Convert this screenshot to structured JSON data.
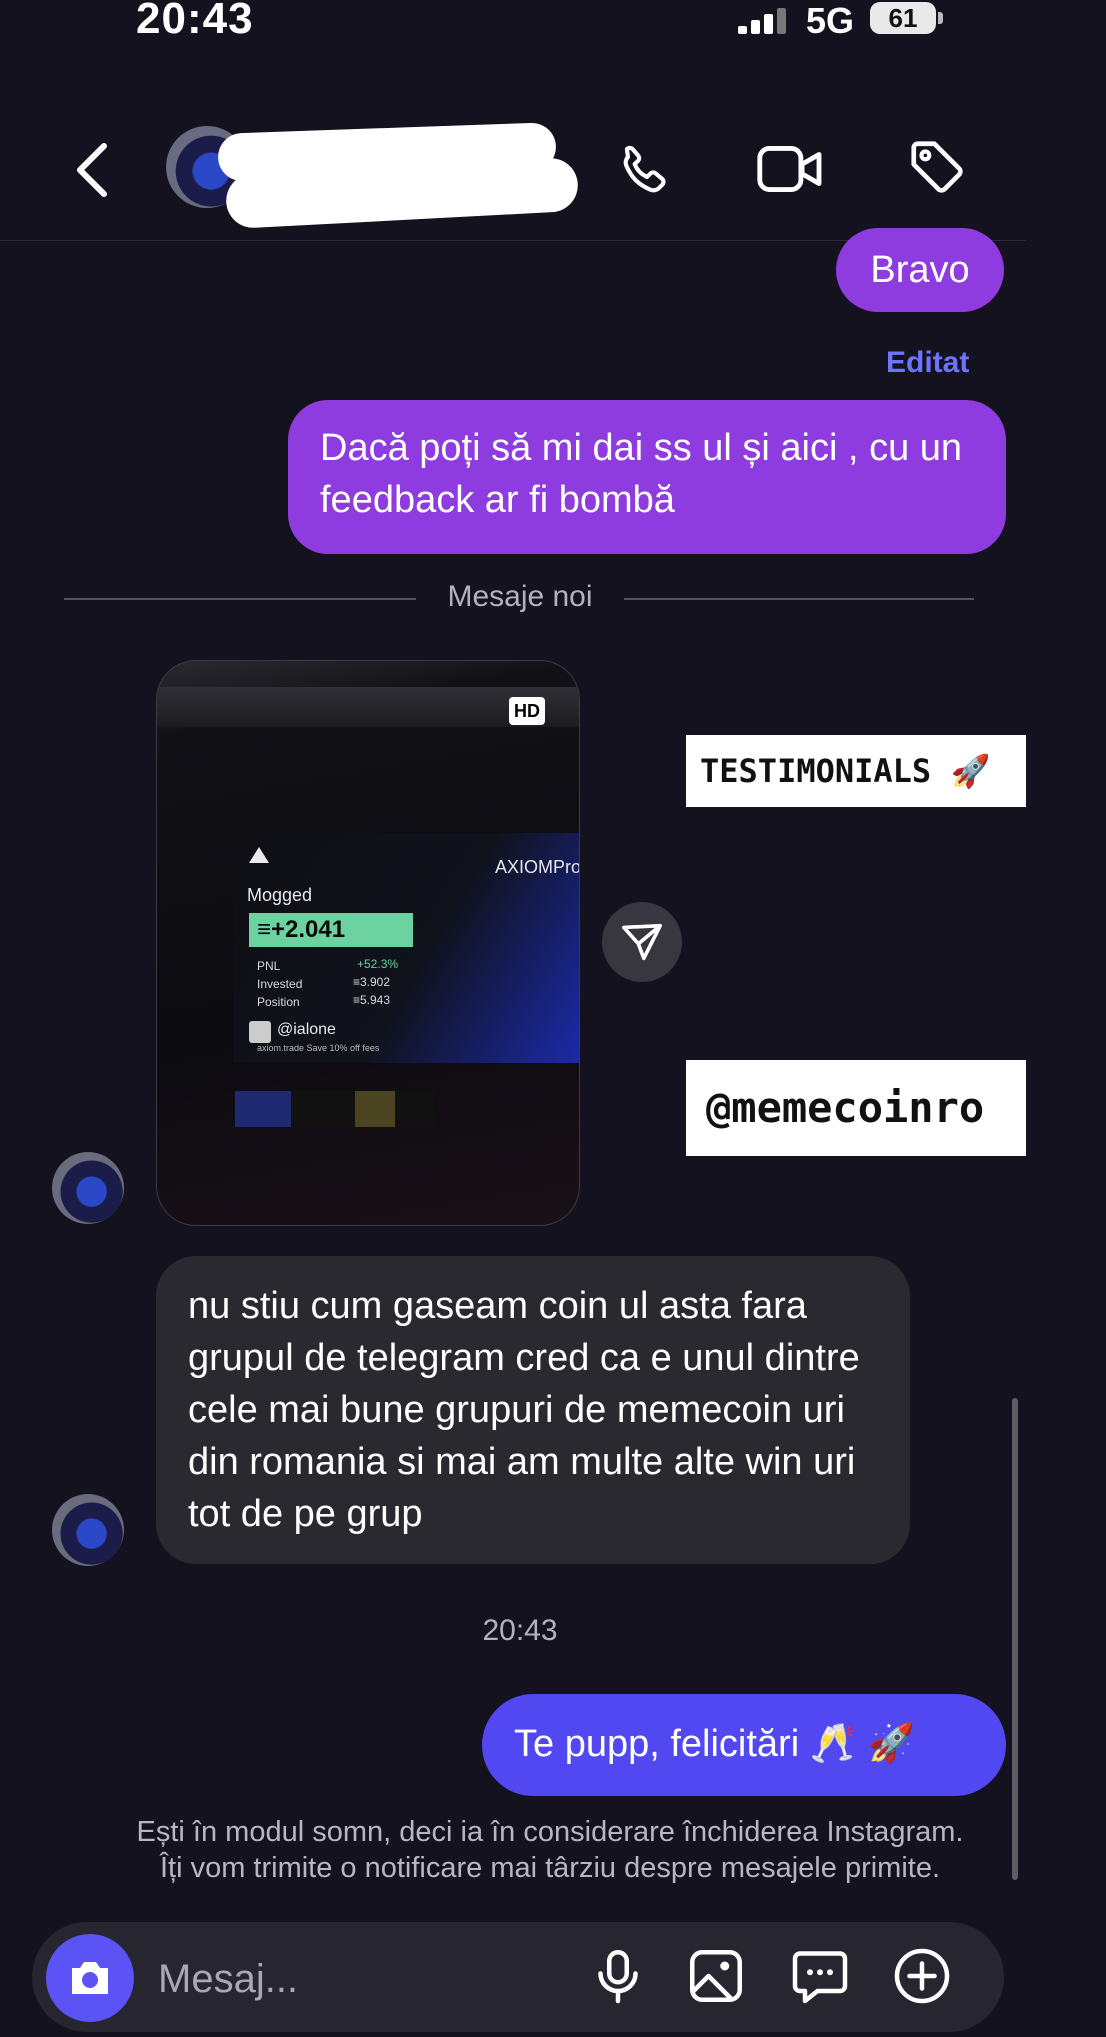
{
  "status_bar": {
    "time": "20:43",
    "network": "5G",
    "battery": "61"
  },
  "header": {
    "icons": [
      "back-icon",
      "phone-icon",
      "video-icon",
      "tag-icon"
    ]
  },
  "messages": {
    "m1": "Bravo",
    "edited_label": "Editat",
    "m2": "Dacă poți să mi dai ss ul și aici , cu un feedback ar fi bombă",
    "divider": "Mesaje noi",
    "photo": {
      "hd_badge": "HD",
      "brand": "AXIOMPro",
      "title": "Mogged",
      "pnl_big": "≡+2.041",
      "rows": [
        {
          "label": "PNL",
          "value": "+52.3%"
        },
        {
          "label": "Invested",
          "value": "≡3.902"
        },
        {
          "label": "Position",
          "value": "≡5.943"
        }
      ],
      "user": "@ialone",
      "sub": "axiom.trade   Save 10% off fees"
    },
    "m3": "nu stiu cum gaseam coin ul asta fara grupul de telegram cred ca e unul dintre cele mai bune grupuri de memecoin uri din romania si mai am multe alte win uri tot de pe grup",
    "time_label": "20:43",
    "m4": "Te pupp, felicitări 🥂 🚀"
  },
  "stickers": {
    "testimonials": "TESTIMONIALS 🚀",
    "handle": "@memecoinro"
  },
  "sleep_note": {
    "line1": "Ești în modul somn, deci ia în considerare închiderea Instagram.",
    "line2": "Îți vom trimite o notificare mai târziu despre mesajele primite."
  },
  "composer": {
    "placeholder": "Mesaj...",
    "icons": [
      "camera-icon",
      "microphone-icon",
      "gallery-icon",
      "sticker-icon",
      "plus-icon"
    ]
  },
  "colors": {
    "background": "#15121f",
    "outgoing_bubble": "#8e3ce0",
    "outgoing_bubble_last": "#5148f2",
    "incoming_bubble": "#2a2930",
    "accent_link": "#6d74ff"
  }
}
